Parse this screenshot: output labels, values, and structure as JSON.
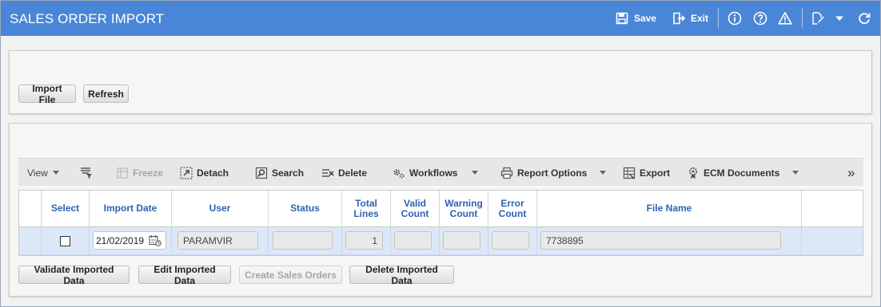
{
  "header": {
    "title": "SALES ORDER IMPORT",
    "save_label": "Save",
    "exit_label": "Exit",
    "icons": [
      "save-icon",
      "exit-icon",
      "info-icon",
      "help-icon",
      "warning-icon",
      "edit-icon",
      "chevron-down-icon",
      "refresh-icon"
    ]
  },
  "actions": {
    "import_file": "Import File",
    "refresh": "Refresh"
  },
  "toolbar": {
    "view": "View",
    "freeze": "Freeze",
    "detach": "Detach",
    "search": "Search",
    "delete": "Delete",
    "workflows": "Workflows",
    "report_options": "Report Options",
    "export": "Export",
    "ecm_documents": "ECM Documents",
    "more": "»"
  },
  "grid": {
    "columns": {
      "select": "Select",
      "import_date": "Import Date",
      "user": "User",
      "status": "Status",
      "total_lines": "Total Lines",
      "valid_count": "Valid Count",
      "warning_count": "Warning Count",
      "error_count": "Error Count",
      "file_name": "File Name"
    },
    "rows": [
      {
        "selected": false,
        "import_date": "21/02/2019",
        "user": "PARAMVIR",
        "status": "",
        "total_lines": "1",
        "valid_count": "",
        "warning_count": "",
        "error_count": "",
        "file_name": "7738895"
      }
    ]
  },
  "bottom_buttons": {
    "validate": "Validate Imported Data",
    "edit": "Edit Imported Data",
    "create": "Create Sales Orders",
    "delete": "Delete Imported Data"
  },
  "colors": {
    "header_bg": "#4a86d8",
    "column_header_text": "#2f62b0",
    "selected_row": "#dce7f7"
  }
}
